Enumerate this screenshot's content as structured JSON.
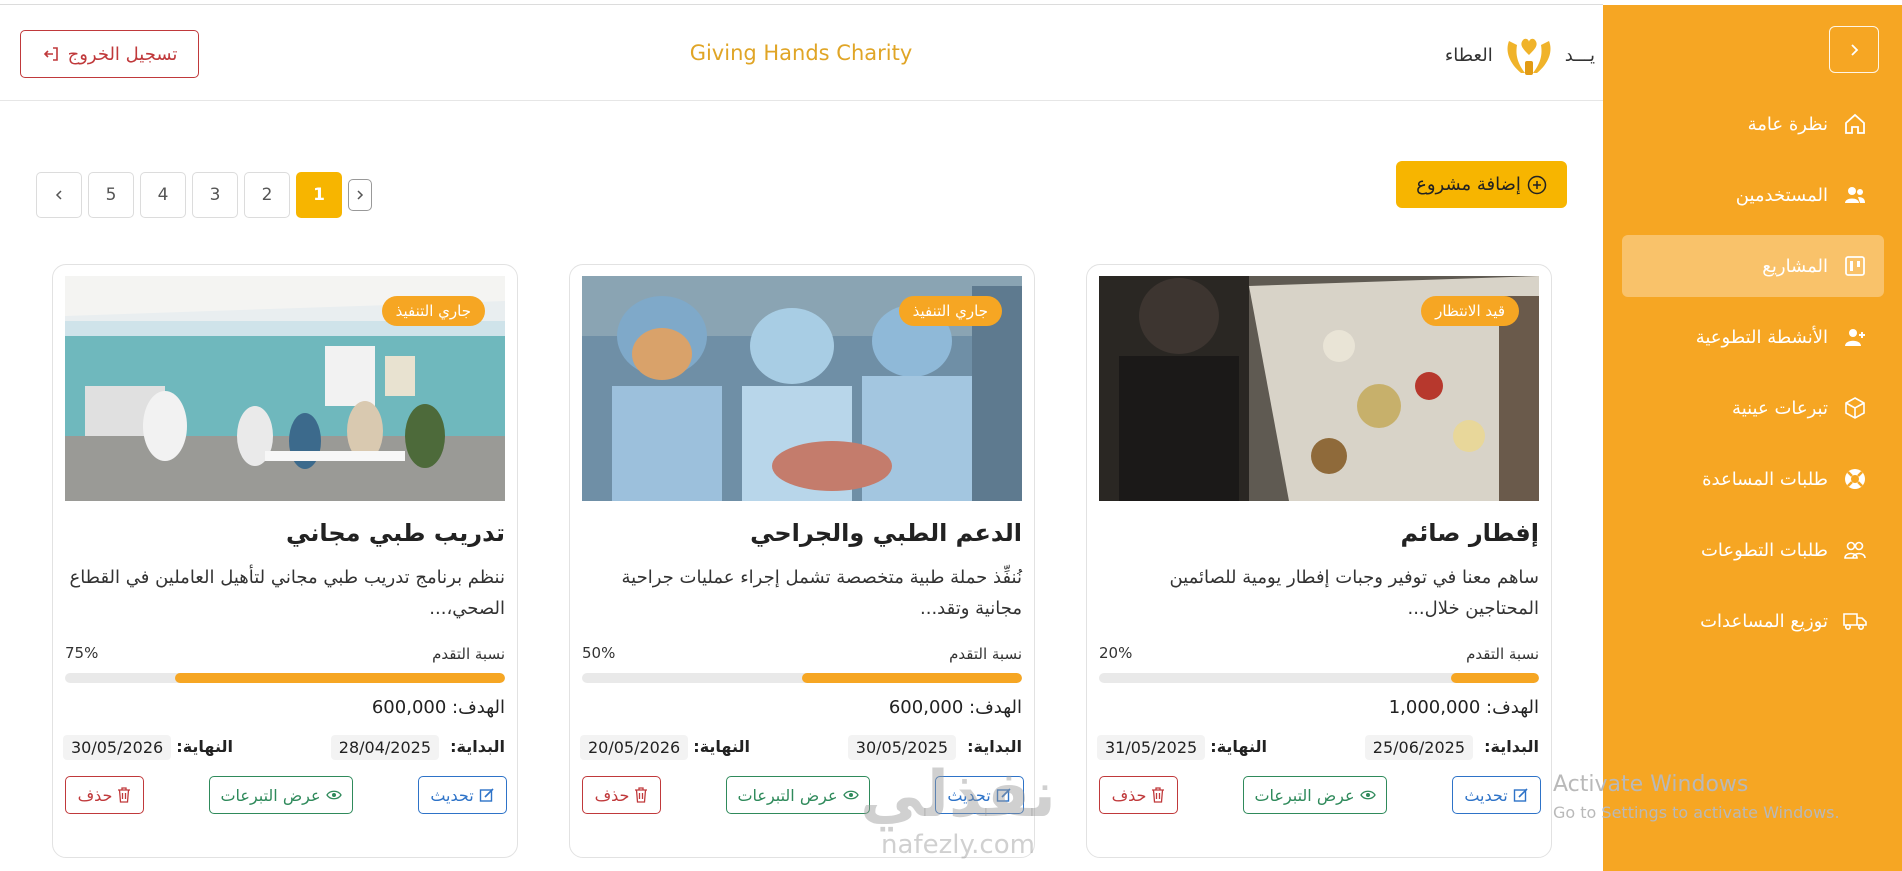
{
  "header": {
    "title": "Giving Hands Charity",
    "logout_label": "تسجيل الخروج",
    "logo_word_right": "يـــد",
    "logo_word_left": "العطاء"
  },
  "sidebar": {
    "items": [
      {
        "label": "نظرة عامة",
        "icon": "home-icon",
        "active": false
      },
      {
        "label": "المستخدمين",
        "icon": "users-icon",
        "active": false
      },
      {
        "label": "المشاريع",
        "icon": "kanban-icon",
        "active": true
      },
      {
        "label": "الأنشطة التطوعية",
        "icon": "user-plus-icon",
        "active": false
      },
      {
        "label": "تبرعات عينية",
        "icon": "box-icon",
        "active": false
      },
      {
        "label": "طلبات المساعدة",
        "icon": "lifebuoy-icon",
        "active": false
      },
      {
        "label": "طلبات التطوعات",
        "icon": "people-icon",
        "active": false
      },
      {
        "label": "توزيع المساعدات",
        "icon": "truck-icon",
        "active": false
      }
    ]
  },
  "toolbar": {
    "add_project_label": "إضافة مشروع"
  },
  "pagination": {
    "pages": [
      "1",
      "2",
      "3",
      "4",
      "5"
    ],
    "current": "1"
  },
  "cards": [
    {
      "status": "قيد الانتظار",
      "title": "إفطار صائم",
      "description": "ساهم معنا في توفير وجبات إفطار يومية للصائمين المحتاجين خلال...",
      "progress_label": "نسبة التقدم",
      "progress_text": "20%",
      "progress": 20,
      "goal_label": "الهدف:",
      "goal_value": "1,000,000",
      "start_label": "البداية:",
      "start_date": "25/06/2025",
      "end_label": "النهاية:",
      "end_date": "31/05/2025",
      "update_label": "تحديث",
      "view_label": "عرض التبرعات",
      "delete_label": "حذف"
    },
    {
      "status": "جاري التنفيذ",
      "title": "الدعم الطبي والجراحي",
      "description": "نُنفِّذ حملة طبية متخصصة تشمل إجراء عمليات جراحية مجانية وتقد...",
      "progress_label": "نسبة التقدم",
      "progress_text": "50%",
      "progress": 50,
      "goal_label": "الهدف:",
      "goal_value": "600,000",
      "start_label": "البداية:",
      "start_date": "30/05/2025",
      "end_label": "النهاية:",
      "end_date": "20/05/2026",
      "update_label": "تحديث",
      "view_label": "عرض التبرعات",
      "delete_label": "حذف"
    },
    {
      "status": "جاري التنفيذ",
      "title": "تدريب طبي مجاني",
      "description": "ننظم برنامج تدريب طبي مجاني لتأهيل العاملين في القطاع الصحي،...",
      "progress_label": "نسبة التقدم",
      "progress_text": "75%",
      "progress": 75,
      "goal_label": "الهدف:",
      "goal_value": "600,000",
      "start_label": "البداية:",
      "start_date": "28/04/2025",
      "end_label": "النهاية:",
      "end_date": "30/05/2026",
      "update_label": "تحديث",
      "view_label": "عرض التبرعات",
      "delete_label": "حذف"
    }
  ],
  "watermark": {
    "activate_title": "Activate Windows",
    "activate_sub": "Go to Settings to activate Windows.",
    "brand_ar": "نفذلي",
    "brand_en": "nafezly.com"
  },
  "colors": {
    "sidebar": "#f6a623",
    "accent": "#f7b500",
    "title": "#e0a526",
    "danger": "#c0393b",
    "primary": "#2e73c8",
    "success": "#2f8a5b"
  }
}
